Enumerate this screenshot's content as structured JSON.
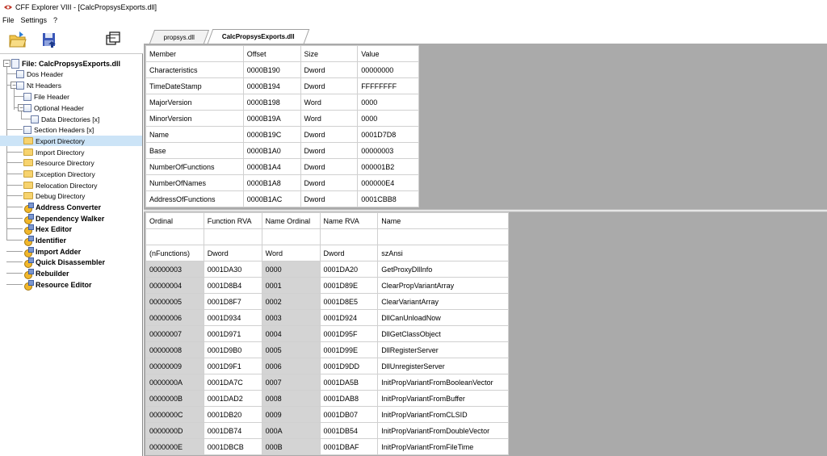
{
  "window": {
    "title": "CFF Explorer VIII - [CalcPropsysExports.dll]"
  },
  "menu": [
    "File",
    "Settings",
    "?"
  ],
  "tabs": [
    {
      "label": "propsys.dll",
      "active": false
    },
    {
      "label": "CalcPropsysExports.dll",
      "active": true
    }
  ],
  "tree": {
    "root": "File: CalcPropsysExports.dll",
    "nodes": [
      {
        "label": "Dos Header",
        "icon": "doc"
      },
      {
        "label": "Nt Headers",
        "icon": "doc"
      },
      {
        "label": "File Header",
        "icon": "doc"
      },
      {
        "label": "Optional Header",
        "icon": "doc"
      },
      {
        "label": "Data Directories [x]",
        "icon": "doc"
      },
      {
        "label": "Section Headers [x]",
        "icon": "doc"
      },
      {
        "label": "Export Directory",
        "icon": "folder",
        "selected": true
      },
      {
        "label": "Import Directory",
        "icon": "folder"
      },
      {
        "label": "Resource Directory",
        "icon": "folder"
      },
      {
        "label": "Exception Directory",
        "icon": "folder"
      },
      {
        "label": "Relocation Directory",
        "icon": "folder"
      },
      {
        "label": "Debug Directory",
        "icon": "folder"
      },
      {
        "label": "Address Converter",
        "icon": "tool"
      },
      {
        "label": "Dependency Walker",
        "icon": "tool"
      },
      {
        "label": "Hex Editor",
        "icon": "tool"
      },
      {
        "label": "Identifier",
        "icon": "tool"
      },
      {
        "label": "Import Adder",
        "icon": "tool"
      },
      {
        "label": "Quick Disassembler",
        "icon": "tool"
      },
      {
        "label": "Rebuilder",
        "icon": "tool"
      },
      {
        "label": "Resource Editor",
        "icon": "tool"
      }
    ]
  },
  "top_table": {
    "headers": [
      "Member",
      "Offset",
      "Size",
      "Value"
    ],
    "rows": [
      [
        "Characteristics",
        "0000B190",
        "Dword",
        "00000000"
      ],
      [
        "TimeDateStamp",
        "0000B194",
        "Dword",
        "FFFFFFFF"
      ],
      [
        "MajorVersion",
        "0000B198",
        "Word",
        "0000"
      ],
      [
        "MinorVersion",
        "0000B19A",
        "Word",
        "0000"
      ],
      [
        "Name",
        "0000B19C",
        "Dword",
        "0001D7D8"
      ],
      [
        "Base",
        "0000B1A0",
        "Dword",
        "00000003"
      ],
      [
        "NumberOfFunctions",
        "0000B1A4",
        "Dword",
        "000001B2"
      ],
      [
        "NumberOfNames",
        "0000B1A8",
        "Dword",
        "000000E4"
      ],
      [
        "AddressOfFunctions",
        "0000B1AC",
        "Dword",
        "0001CBB8"
      ]
    ]
  },
  "bottom_table": {
    "headers": [
      "Ordinal",
      "Function RVA",
      "Name Ordinal",
      "Name RVA",
      "Name"
    ],
    "types": [
      "(nFunctions)",
      "Dword",
      "Word",
      "Dword",
      "szAnsi"
    ],
    "rows": [
      [
        "00000003",
        "0001DA30",
        "0000",
        "0001DA20",
        "GetProxyDllInfo"
      ],
      [
        "00000004",
        "0001D8B4",
        "0001",
        "0001D89E",
        "ClearPropVariantArray"
      ],
      [
        "00000005",
        "0001D8F7",
        "0002",
        "0001D8E5",
        "ClearVariantArray"
      ],
      [
        "00000006",
        "0001D934",
        "0003",
        "0001D924",
        "DllCanUnloadNow"
      ],
      [
        "00000007",
        "0001D971",
        "0004",
        "0001D95F",
        "DllGetClassObject"
      ],
      [
        "00000008",
        "0001D9B0",
        "0005",
        "0001D99E",
        "DllRegisterServer"
      ],
      [
        "00000009",
        "0001D9F1",
        "0006",
        "0001D9DD",
        "DllUnregisterServer"
      ],
      [
        "0000000A",
        "0001DA7C",
        "0007",
        "0001DA5B",
        "InitPropVariantFromBooleanVector"
      ],
      [
        "0000000B",
        "0001DAD2",
        "0008",
        "0001DAB8",
        "InitPropVariantFromBuffer"
      ],
      [
        "0000000C",
        "0001DB20",
        "0009",
        "0001DB07",
        "InitPropVariantFromCLSID"
      ],
      [
        "0000000D",
        "0001DB74",
        "000A",
        "0001DB54",
        "InitPropVariantFromDoubleVector"
      ],
      [
        "0000000E",
        "0001DBCB",
        "000B",
        "0001DBAF",
        "InitPropVariantFromFileTime"
      ]
    ]
  }
}
